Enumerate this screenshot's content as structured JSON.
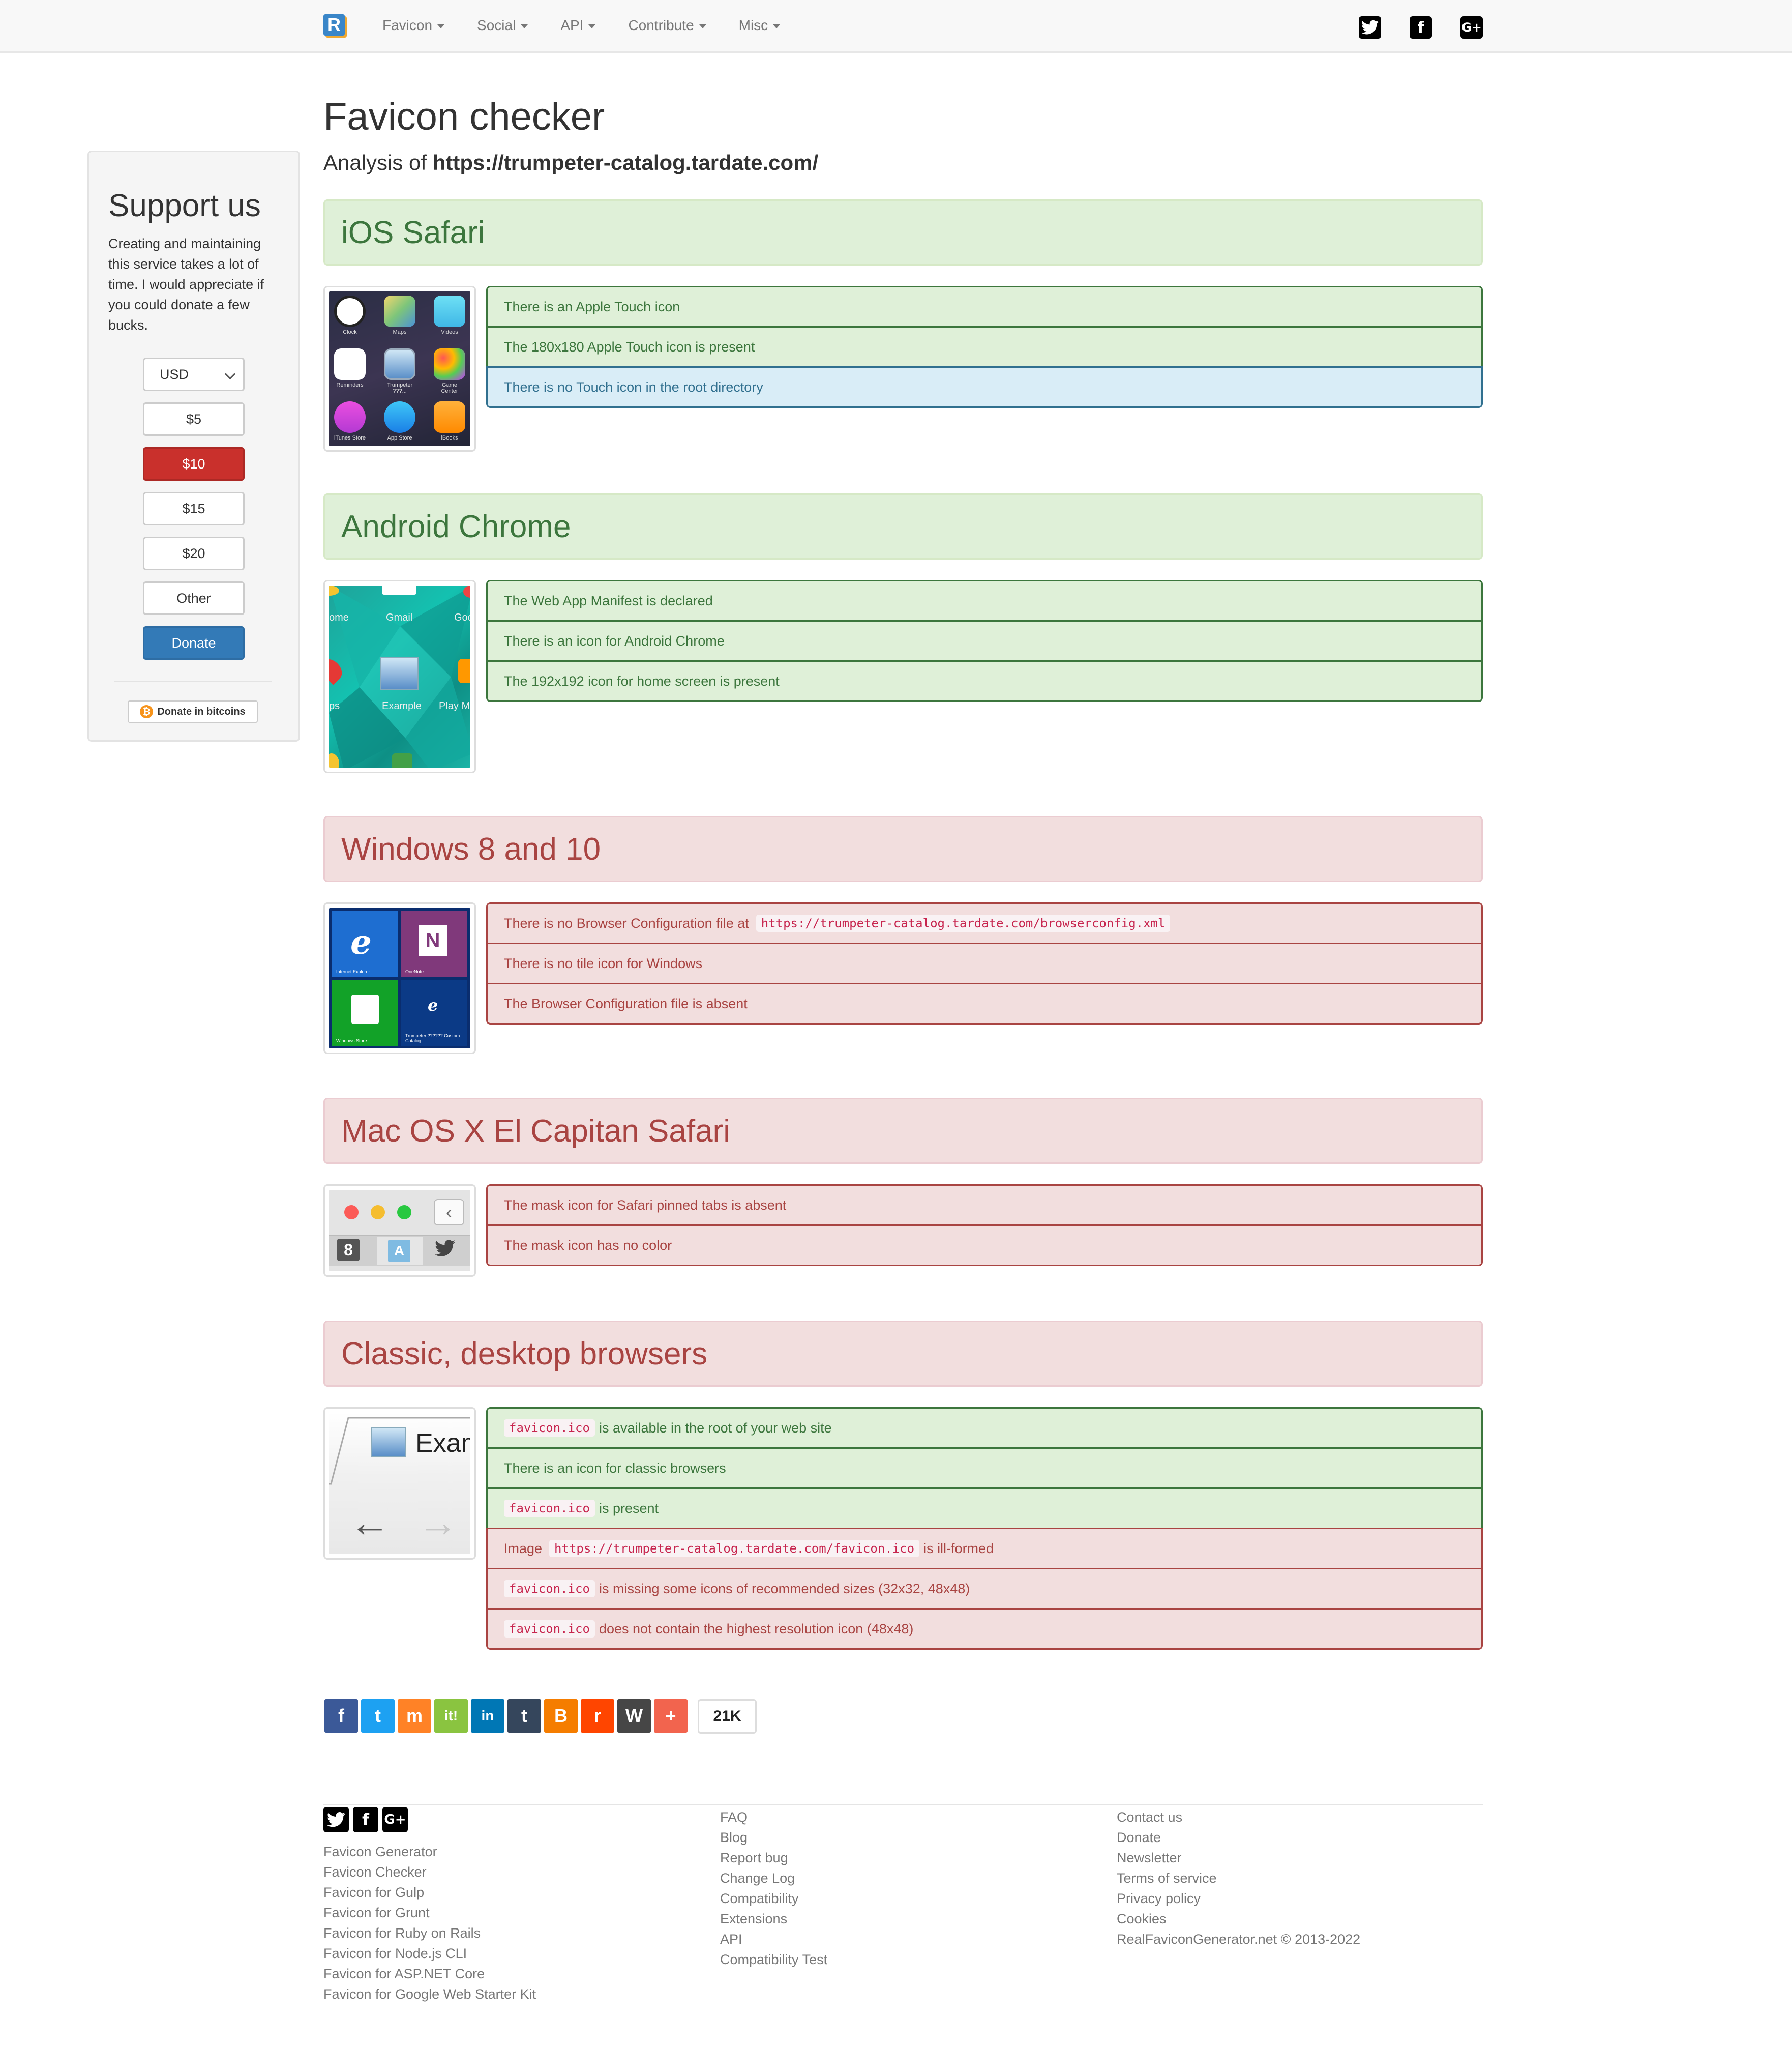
{
  "nav": {
    "brand": "R",
    "menu": [
      {
        "label": "Favicon"
      },
      {
        "label": "Social"
      },
      {
        "label": "API"
      },
      {
        "label": "Contribute"
      },
      {
        "label": "Misc"
      }
    ],
    "social": {
      "twitter": "twitter-icon",
      "facebook": "facebook-icon",
      "googleplus": "google-plus-icon"
    }
  },
  "sidebar": {
    "title": "Support us",
    "description": "Creating and maintaining this service takes a lot of time. I would appreciate if you could donate a few bucks.",
    "currency": "USD",
    "amounts": [
      "$5",
      "$10",
      "$15",
      "$20",
      "Other"
    ],
    "selected_amount": "$10",
    "donate_label": "Donate",
    "bitcoin_label": "Donate in bitcoins"
  },
  "main": {
    "title": "Favicon checker",
    "analysis_prefix": "Analysis of",
    "analysis_url": "https://trumpeter-catalog.tardate.com/",
    "sections": {
      "ios": {
        "title": "iOS Safari",
        "status": "ok",
        "checks": [
          {
            "text": "There is an Apple Touch icon",
            "status": "ok"
          },
          {
            "text": "The 180x180 Apple Touch icon is present",
            "status": "ok"
          },
          {
            "text": "There is no Touch icon in the root directory",
            "status": "info"
          }
        ],
        "apps": [
          "Clock",
          "Maps",
          "Videos",
          "Reminders",
          "Trumpeter ???...",
          "Game Center",
          "iTunes Store",
          "App Store",
          "iBooks"
        ]
      },
      "android": {
        "title": "Android Chrome",
        "status": "ok",
        "checks": [
          {
            "text": "The Web App Manifest is declared",
            "status": "ok"
          },
          {
            "text": "There is an icon for Android Chrome",
            "status": "ok"
          },
          {
            "text": "The 192x192 icon for home screen is present",
            "status": "ok"
          }
        ],
        "apps": [
          "ome",
          "Gmail",
          "Goo",
          "ps",
          "Example",
          "Play M"
        ]
      },
      "windows": {
        "title": "Windows 8 and 10",
        "status": "bad",
        "checks": [
          {
            "pre": "There is no Browser Configuration file at",
            "code": "https://trumpeter-catalog.tardate.com/browserconfig.xml",
            "status": "bad"
          },
          {
            "text": "There is no tile icon for Windows",
            "status": "bad"
          },
          {
            "text": "The Browser Configuration file is absent",
            "status": "bad"
          }
        ],
        "tiles": [
          "Internet Explorer",
          "OneNote",
          "Windows Store",
          "Trumpeter ?????? Custom Catalog"
        ]
      },
      "mac": {
        "title": "Mac OS X El Capitan Safari",
        "status": "bad",
        "checks": [
          {
            "text": "The mask icon for Safari pinned tabs is absent",
            "status": "bad"
          },
          {
            "text": "The mask icon has no color",
            "status": "bad"
          }
        ]
      },
      "classic": {
        "title": "Classic, desktop browsers",
        "status": "bad",
        "tab_label": "Exam",
        "checks": [
          {
            "code": "favicon.ico",
            "post": "is available in the root of your web site",
            "status": "ok"
          },
          {
            "text": "There is an icon for classic browsers",
            "status": "ok"
          },
          {
            "code": "favicon.ico",
            "post": "is present",
            "status": "ok"
          },
          {
            "pre": "Image",
            "code": "https://trumpeter-catalog.tardate.com/favicon.ico",
            "post": "is ill-formed",
            "status": "bad"
          },
          {
            "code": "favicon.ico",
            "post": "is missing some icons of recommended sizes (32x32, 48x48)",
            "status": "bad"
          },
          {
            "code": "favicon.ico",
            "post": "does not contain the highest resolution icon (48x48)",
            "status": "bad"
          }
        ]
      }
    }
  },
  "share": {
    "buttons": [
      {
        "icon": "facebook-icon",
        "glyph": "f",
        "color": "#3b5998"
      },
      {
        "icon": "twitter-icon",
        "glyph": "t",
        "color": "#1da1f2"
      },
      {
        "icon": "mix-icon",
        "glyph": "m",
        "color": "#ff8226"
      },
      {
        "icon": "itjuzi-icon",
        "glyph": "it!",
        "color": "#8ac440"
      },
      {
        "icon": "linkedin-icon",
        "glyph": "in",
        "color": "#0077b5"
      },
      {
        "icon": "tumblr-icon",
        "glyph": "t",
        "color": "#35465c"
      },
      {
        "icon": "blogger-icon",
        "glyph": "B",
        "color": "#f57d00"
      },
      {
        "icon": "reddit-icon",
        "glyph": "r",
        "color": "#ff4500"
      },
      {
        "icon": "wordpress-icon",
        "glyph": "W",
        "color": "#464646"
      },
      {
        "icon": "addthis-icon",
        "glyph": "+",
        "color": "#f2644e"
      }
    ],
    "count": "21K"
  },
  "footer": {
    "col1": [
      "Favicon Generator",
      "Favicon Checker",
      "Favicon for Gulp",
      "Favicon for Grunt",
      "Favicon for Ruby on Rails",
      "Favicon for Node.js CLI",
      "Favicon for ASP.NET Core",
      "Favicon for Google Web Starter Kit"
    ],
    "col2": [
      "FAQ",
      "Blog",
      "Report bug",
      "Change Log",
      "Compatibility",
      "Extensions",
      "API",
      "Compatibility Test"
    ],
    "col3": [
      "Contact us",
      "Donate",
      "Newsletter",
      "Terms of service",
      "Privacy policy",
      "Cookies",
      "RealFaviconGenerator.net © 2013-2022"
    ]
  }
}
